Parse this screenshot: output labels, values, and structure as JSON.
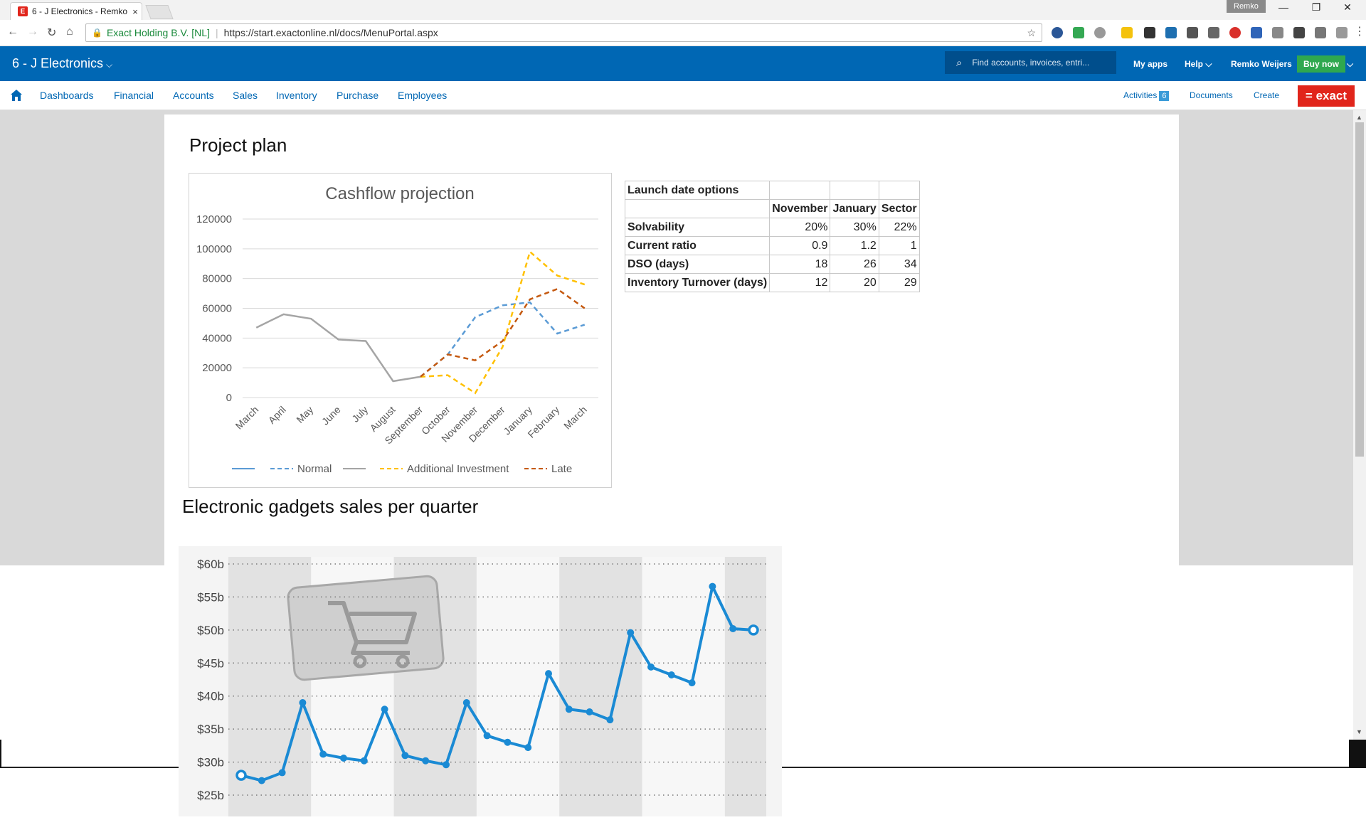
{
  "browser": {
    "tab_title": "6 - J Electronics - Remko",
    "tab_close": "×",
    "profile_name": "Remko",
    "url_cert": "Exact Holding B.V. [NL]",
    "url": "https://start.exactonline.nl/docs/MenuPortal.aspx"
  },
  "header": {
    "company": "6 - J Electronics",
    "search_placeholder": "Find accounts, invoices, entri...",
    "my_apps": "My apps",
    "help": "Help",
    "user": "Remko Weijers",
    "buy_now": "Buy now"
  },
  "nav": {
    "items": [
      "Dashboards",
      "Financial",
      "Accounts",
      "Sales",
      "Inventory",
      "Purchase",
      "Employees"
    ],
    "activities": "Activities",
    "activities_count": "6",
    "documents": "Documents",
    "create": "Create",
    "logo": "= exact"
  },
  "page": {
    "title": "Project plan",
    "section2_title": "Electronic gadgets sales per quarter"
  },
  "launch_table": {
    "title": "Launch date options",
    "columns": [
      "November",
      "January",
      "Sector"
    ],
    "rows": [
      {
        "label": "Solvability",
        "values": [
          "20%",
          "30%",
          "22%"
        ]
      },
      {
        "label": "Current ratio",
        "values": [
          "0.9",
          "1.2",
          "1"
        ]
      },
      {
        "label": "DSO (days)",
        "values": [
          "18",
          "26",
          "34"
        ]
      },
      {
        "label": "Inventory Turnover (days)",
        "values": [
          "12",
          "20",
          "29"
        ]
      }
    ]
  },
  "chart_data": [
    {
      "type": "line",
      "title": "Cashflow projection",
      "categories": [
        "March",
        "April",
        "May",
        "June",
        "July",
        "August",
        "September",
        "October",
        "November",
        "December",
        "January",
        "February",
        "March"
      ],
      "ylim": [
        0,
        120000
      ],
      "yticks": [
        0,
        20000,
        40000,
        60000,
        80000,
        100000,
        120000
      ],
      "grid": true,
      "legend_position": "bottom",
      "series": [
        {
          "name": "",
          "style": "solid",
          "color": "#5b9bd5",
          "values": [
            null,
            null,
            null,
            null,
            null,
            null,
            null,
            null,
            null,
            null,
            null,
            null,
            null
          ]
        },
        {
          "name": "Normal",
          "style": "dashed",
          "color": "#5b9bd5",
          "values": [
            null,
            null,
            null,
            null,
            null,
            null,
            14000,
            29000,
            54000,
            62000,
            64000,
            43000,
            49000
          ]
        },
        {
          "name": "",
          "style": "solid",
          "color": "#a5a5a5",
          "values": [
            47000,
            56000,
            53000,
            39000,
            38000,
            11000,
            14000,
            null,
            null,
            null,
            null,
            null,
            null
          ]
        },
        {
          "name": "Additional Investment",
          "style": "dashed",
          "color": "#ffc000",
          "values": [
            null,
            null,
            null,
            null,
            null,
            null,
            14000,
            15000,
            3000,
            34000,
            98000,
            82000,
            76000
          ]
        },
        {
          "name": "Late",
          "style": "dashed",
          "color": "#c55a11",
          "values": [
            null,
            null,
            null,
            null,
            null,
            null,
            14000,
            29000,
            25000,
            38000,
            66000,
            73000,
            60000
          ]
        }
      ]
    },
    {
      "type": "line",
      "title": "",
      "y_tick_labels": [
        "$25b",
        "$30b",
        "$35b",
        "$40b",
        "$45b",
        "$50b",
        "$55b",
        "$60b"
      ],
      "yticks": [
        25,
        30,
        35,
        40,
        45,
        50,
        55,
        60
      ],
      "ylim": [
        25,
        60
      ],
      "grid": true,
      "color": "#1a8ad4",
      "series": [
        {
          "name": "",
          "values": [
            28,
            27.2,
            28.4,
            39,
            31.2,
            30.6,
            30.2,
            38,
            31,
            30.2,
            29.6,
            39,
            34,
            33,
            32.2,
            43.4,
            38,
            37.6,
            36.4,
            49.6,
            44.4,
            43.2,
            42,
            56.6,
            50.2,
            50
          ]
        }
      ]
    }
  ]
}
